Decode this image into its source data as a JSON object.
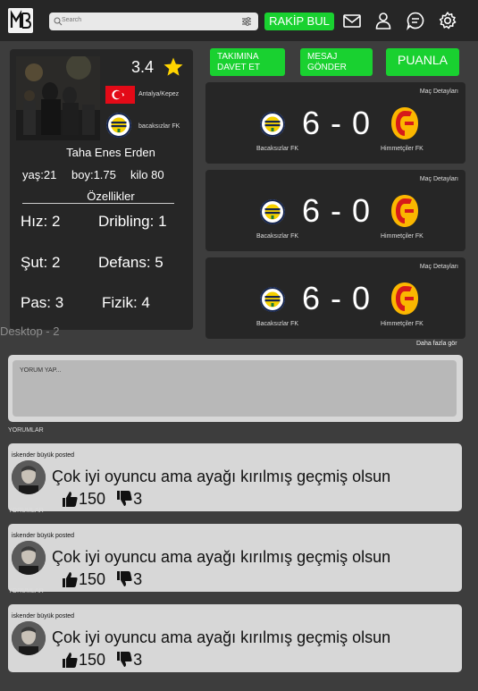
{
  "nav": {
    "logo_text": "MB",
    "search_placeholder": "Search",
    "rakip_label": "RAKİP BUL",
    "icons": [
      "mail-icon",
      "user-icon",
      "chat-icon",
      "gear-icon"
    ]
  },
  "profile": {
    "rating": "3.4",
    "location": "Antalya/Kepez",
    "club": "bacaksızlar FK",
    "name": "Taha Enes Erden",
    "age": "yaş:21",
    "height": "boy:1.75",
    "weight": "kilo 80",
    "features_title": "Özellikler",
    "stats": {
      "speed": "Hız: 2",
      "dribbling": "Dribling: 1",
      "shot": "Şut: 2",
      "defense": "Defans: 5",
      "pass": "Pas: 3",
      "physical": "Fizik: 4"
    }
  },
  "actions": {
    "invite_line1": "TAKIMINA",
    "invite_line2": "DAVET ET",
    "message_line1": "MESAJ",
    "message_line2": "GÖNDER",
    "rate": "PUANLA"
  },
  "matches": [
    {
      "detail": "Maç Detayları",
      "home": "Bacaksızlar FK",
      "away": "Himmetçiler FK",
      "score": "6 - 0"
    },
    {
      "detail": "Maç Detayları",
      "home": "Bacaksızlar FK",
      "away": "Himmetçiler FK",
      "score": "6 - 0"
    },
    {
      "detail": "Maç Detayları",
      "home": "Bacaksızlar FK",
      "away": "Himmetçiler FK",
      "score": "6 - 0"
    }
  ],
  "more_label": "Daha fazla gör",
  "desktop_label": "Desktop - 2",
  "comment_input_placeholder": "YORUM YAP...",
  "comments_label": "YORUMLAR",
  "comments": [
    {
      "author": "iskender büyük posted",
      "text": "Çok iyi oyuncu ama ayağı kırılmış geçmiş olsun",
      "likes": "150",
      "dislikes": "3"
    },
    {
      "author": "iskender büyük posted",
      "text": "Çok iyi oyuncu ama ayağı kırılmış geçmiş olsun",
      "likes": "150",
      "dislikes": "3"
    },
    {
      "author": "iskender büyük posted",
      "text": "Çok iyi oyuncu ama ayağı kırılmış geçmiş olsun",
      "likes": "150",
      "dislikes": "3"
    }
  ],
  "colors": {
    "accent_green": "#19d130",
    "card_bg": "#262626",
    "page_bg": "#3d3d3d",
    "comment_bg": "#d7d7d7"
  }
}
